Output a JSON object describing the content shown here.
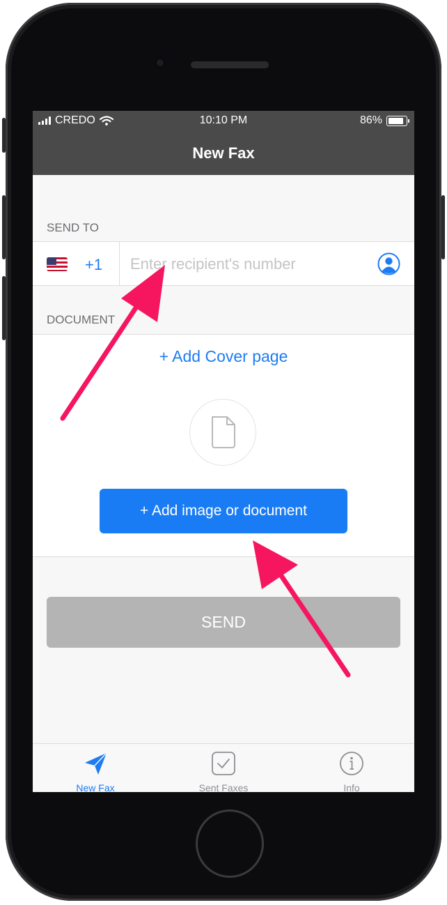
{
  "status_bar": {
    "carrier": "CREDO",
    "time": "10:10 PM",
    "battery": "86%",
    "icons": [
      "signal-bars-icon",
      "wifi-icon",
      "battery-icon"
    ]
  },
  "nav": {
    "title": "New Fax"
  },
  "send_to": {
    "header": "SEND TO",
    "country_code": "+1",
    "country_flag": "us-flag-icon",
    "recipient_placeholder": "Enter recipient's number",
    "contact_icon": "person-icon"
  },
  "documents": {
    "header": "DOCUMENT",
    "add_cover_label": "+ Add Cover page",
    "placeholder_icon": "document-icon",
    "add_document_label": "+ Add image or document"
  },
  "send": {
    "label": "SEND"
  },
  "tab_bar": {
    "tabs": [
      {
        "label": "New Fax",
        "icon": "paper-plane-icon",
        "active": true
      },
      {
        "label": "Sent Faxes",
        "icon": "checkbox-icon",
        "active": false
      },
      {
        "label": "Info",
        "icon": "info-icon",
        "active": false
      }
    ]
  },
  "colors": {
    "accent": "#1d7cf2",
    "nav_background": "#4a4a4a",
    "disabled_button": "#b4b4b4",
    "annotation_arrow": "#f5165f",
    "inactive_tab": "#8e8e93"
  }
}
